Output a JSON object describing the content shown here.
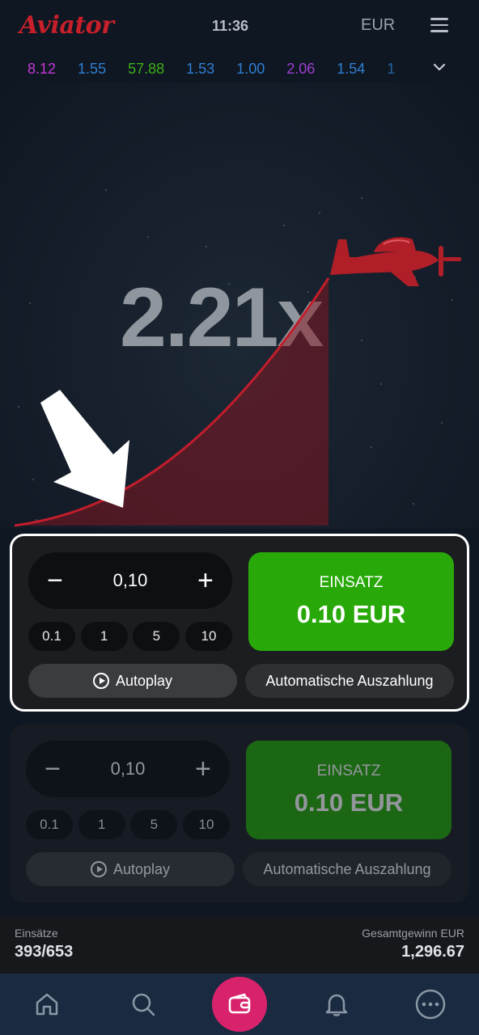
{
  "header": {
    "logo": "Aviator",
    "time": "11:36",
    "currency": "EUR"
  },
  "history": [
    {
      "value": "8.12",
      "color": "#c239d6"
    },
    {
      "value": "1.55",
      "color": "#2f7fd0"
    },
    {
      "value": "57.88",
      "color": "#3fae19"
    },
    {
      "value": "1.53",
      "color": "#2f7fd0"
    },
    {
      "value": "1.00",
      "color": "#2f7fd0"
    },
    {
      "value": "2.06",
      "color": "#9c3fd3"
    },
    {
      "value": "1.54",
      "color": "#2f7fd0"
    },
    {
      "value": "1",
      "color": "#2f7fd0"
    }
  ],
  "game": {
    "multiplier": "2.21x"
  },
  "bet_panels": [
    {
      "amount": "0,10",
      "chips": [
        "0.1",
        "1",
        "5",
        "10"
      ],
      "bet_label": "EINSATZ",
      "bet_amount": "0.10 EUR",
      "autoplay": "Autoplay",
      "auto_cashout": "Automatische Auszahlung"
    },
    {
      "amount": "0,10",
      "chips": [
        "0.1",
        "1",
        "5",
        "10"
      ],
      "bet_label": "EINSATZ",
      "bet_amount": "0.10 EUR",
      "autoplay": "Autoplay",
      "auto_cashout": "Automatische Auszahlung"
    }
  ],
  "stats": {
    "bets_label": "Einsätze",
    "bets_value": "393/653",
    "total_win_label": "Gesamtgewinn EUR",
    "total_win_value": "1,296.67"
  },
  "colors": {
    "brand_red": "#c8202a",
    "bet_green": "#28a909",
    "nav_accent": "#d8236c"
  },
  "icons": {
    "menu": "hamburger-icon",
    "expand": "chevron-down-icon",
    "plane": "airplane-icon",
    "arrow": "pointer-arrow-icon",
    "nav": [
      "home-icon",
      "search-icon",
      "wallet-icon",
      "bell-icon",
      "more-icon"
    ]
  }
}
